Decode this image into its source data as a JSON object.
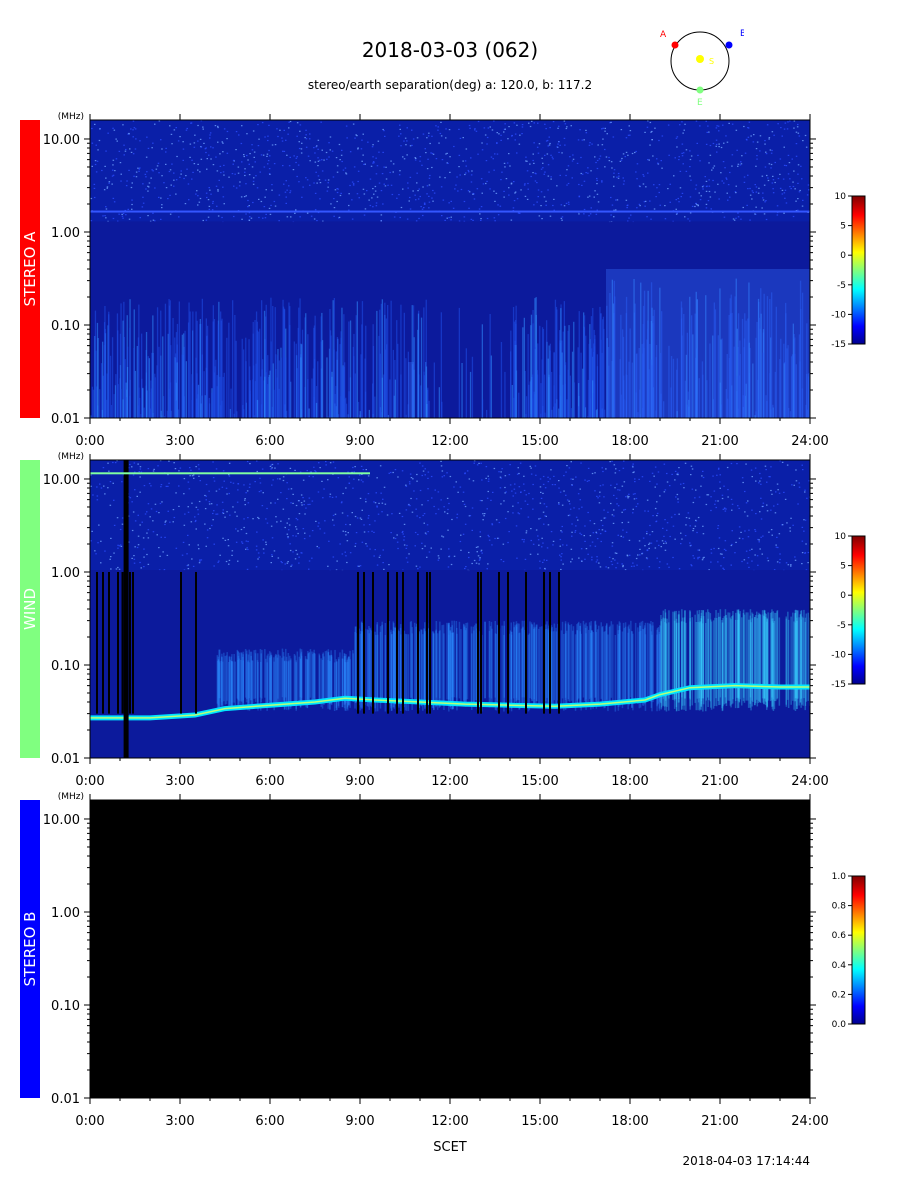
{
  "header": {
    "title": "2018-03-03 (062)",
    "subtitle": "stereo/earth separation(deg) a: 120.0, b: 117.2"
  },
  "orbit_diagram": {
    "labels": {
      "a": "A",
      "b": "B",
      "s": "S",
      "e": "E"
    },
    "colors": {
      "a": "#ff0000",
      "b": "#0000ff",
      "s": "#ffff00",
      "e": "#80ff80"
    }
  },
  "footer": {
    "timestamp": "2018-04-03 17:14:44",
    "x_axis_title": "SCET"
  },
  "chart_data": [
    {
      "type": "heatmap",
      "panel": "STEREO A",
      "label_color": "#ff0000",
      "y_unit": "(MHz)",
      "y_scale": "log",
      "y_ticks": [
        "10.00",
        "1.00",
        "0.10",
        "0.01"
      ],
      "x_ticks": [
        "0:00",
        "3:00",
        "6:00",
        "9:00",
        "12:00",
        "15:00",
        "18:00",
        "21:00",
        "24:00"
      ],
      "xlim": [
        0,
        24
      ],
      "colorbar": {
        "range": [
          -15,
          10
        ],
        "ticks": [
          "10",
          "5",
          "0",
          "-5",
          "-10",
          "-15"
        ]
      },
      "has_data": true,
      "features": [
        {
          "x": [
            10.6,
            10.8
          ],
          "y": [
            0.01,
            0.04
          ]
        },
        {
          "x": [
            17.2,
            24.0
          ],
          "y": [
            0.01,
            0.4
          ]
        }
      ]
    },
    {
      "type": "heatmap",
      "panel": "WIND",
      "label_color": "#80ff80",
      "y_unit": "(MHz)",
      "y_scale": "log",
      "y_ticks": [
        "10.00",
        "1.00",
        "0.10",
        "0.01"
      ],
      "x_ticks": [
        "0:00",
        "3:00",
        "6:00",
        "9:00",
        "12:00",
        "15:00",
        "18:00",
        "21:00",
        "24:00"
      ],
      "xlim": [
        0,
        24
      ],
      "colorbar": {
        "range": [
          -15,
          10
        ],
        "ticks": [
          "10",
          "5",
          "0",
          "-5",
          "-10",
          "-15"
        ]
      },
      "has_data": true,
      "plasma_line_mhz": [
        {
          "x": 0,
          "y": 0.027
        },
        {
          "x": 2.0,
          "y": 0.027
        },
        {
          "x": 3.5,
          "y": 0.029
        },
        {
          "x": 4.5,
          "y": 0.034
        },
        {
          "x": 6.0,
          "y": 0.037
        },
        {
          "x": 7.5,
          "y": 0.04
        },
        {
          "x": 8.5,
          "y": 0.044
        },
        {
          "x": 9.5,
          "y": 0.042
        },
        {
          "x": 11.0,
          "y": 0.04
        },
        {
          "x": 12.5,
          "y": 0.038
        },
        {
          "x": 14.0,
          "y": 0.037
        },
        {
          "x": 15.5,
          "y": 0.036
        },
        {
          "x": 17.0,
          "y": 0.038
        },
        {
          "x": 18.5,
          "y": 0.042
        },
        {
          "x": 19.0,
          "y": 0.048
        },
        {
          "x": 20.0,
          "y": 0.057
        },
        {
          "x": 21.5,
          "y": 0.06
        },
        {
          "x": 23.0,
          "y": 0.058
        },
        {
          "x": 24.0,
          "y": 0.058
        }
      ],
      "data_gaps_hours": [
        0.2,
        0.4,
        0.6,
        0.9,
        1.05,
        1.15,
        1.3,
        1.4,
        3.0,
        3.5,
        8.9,
        9.1,
        9.4,
        9.9,
        10.2,
        10.4,
        10.9,
        11.2,
        11.3,
        12.9,
        13.0,
        13.6,
        13.9,
        14.5,
        15.1,
        15.3,
        15.6
      ]
    },
    {
      "type": "heatmap",
      "panel": "STEREO B",
      "label_color": "#0000ff",
      "y_unit": "(MHz)",
      "y_scale": "log",
      "y_ticks": [
        "10.00",
        "1.00",
        "0.10",
        "0.01"
      ],
      "x_ticks": [
        "0:00",
        "3:00",
        "6:00",
        "9:00",
        "12:00",
        "15:00",
        "18:00",
        "21:00",
        "24:00"
      ],
      "xlim": [
        0,
        24
      ],
      "colorbar": {
        "range": [
          0.0,
          1.0
        ],
        "ticks": [
          "1.0",
          "0.8",
          "0.6",
          "0.4",
          "0.2",
          "0.0"
        ]
      },
      "has_data": false
    }
  ]
}
